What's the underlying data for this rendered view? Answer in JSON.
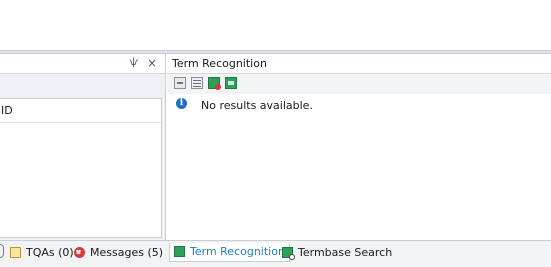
{
  "left_panel": {
    "pin_glyph": "ѱ",
    "close_glyph": "×",
    "column_header": "ID"
  },
  "right_panel": {
    "title": "Term Recognition",
    "toolbar_icons": [
      "term-list-icon",
      "term-details-icon",
      "termbase-delete-icon",
      "termbase-add-icon"
    ],
    "info_glyph": "i",
    "message": "No results available."
  },
  "bottom_tabs": {
    "tqas": "TQAs (0)",
    "messages": "Messages (5)",
    "term_recognition": "Term Recognition",
    "termbase_search": "Termbase Search"
  },
  "colors": {
    "accent": "#1f7fc7",
    "termbase_green": "#2e9f57",
    "error_red": "#d93a3a"
  }
}
